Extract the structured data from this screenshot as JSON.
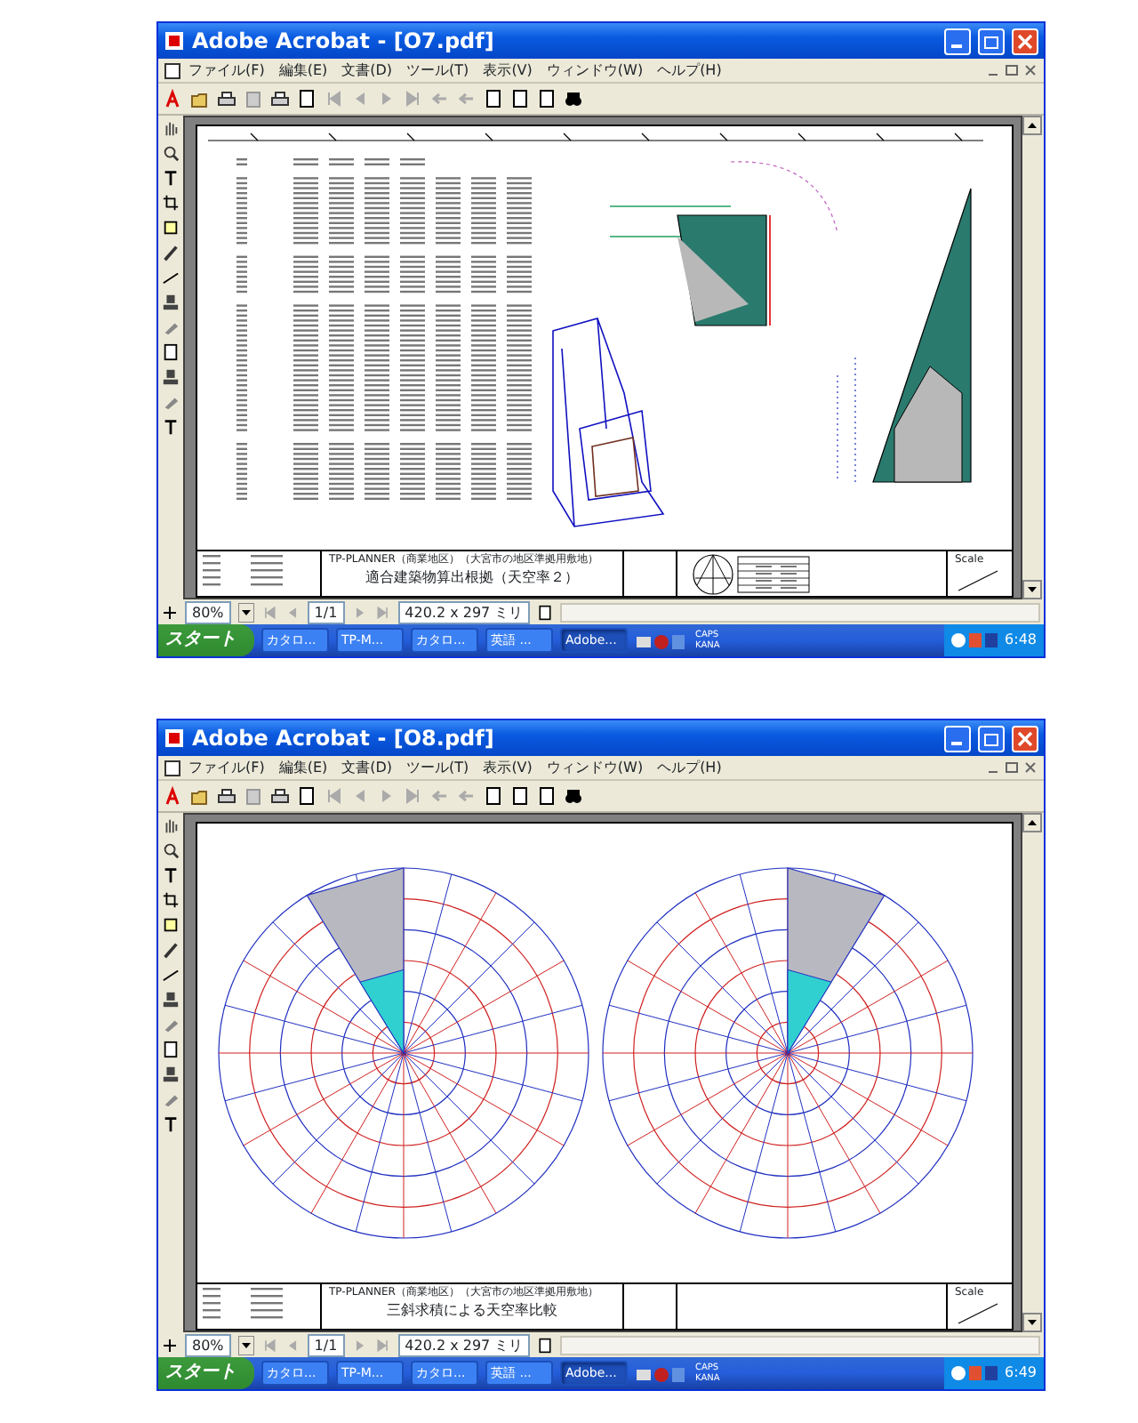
{
  "windows": [
    {
      "title": "Adobe Acrobat - [O7.pdf]",
      "kind": "report",
      "menu": [
        "ファイル(F)",
        "編集(E)",
        "文書(D)",
        "ツール(T)",
        "表示(V)",
        "ウィンドウ(W)",
        "ヘルプ(H)"
      ],
      "title_block": {
        "project": "TP-PLANNER（商業地区）（大宮市の地区準拠用敷地）",
        "title": "適合建築物算出根拠（天空率２）",
        "scale_label": "Scale"
      },
      "status": {
        "zoom": "80%",
        "page": "1/1",
        "size": "420.2 x 297 ミリ"
      },
      "taskbar": {
        "start": "スタート",
        "items": [
          {
            "label": "カタロ...",
            "selected": false
          },
          {
            "label": "TP-M...",
            "selected": false
          },
          {
            "label": "カタロ...",
            "selected": false
          },
          {
            "label": "英語 ...",
            "selected": false
          },
          {
            "label": "Adobe...",
            "selected": true
          }
        ],
        "tray": [
          "CAPS",
          "KANA"
        ],
        "clock": "6:48"
      }
    },
    {
      "title": "Adobe Acrobat - [O8.pdf]",
      "kind": "sky-chart",
      "menu": [
        "ファイル(F)",
        "編集(E)",
        "文書(D)",
        "ツール(T)",
        "表示(V)",
        "ウィンドウ(W)",
        "ヘルプ(H)"
      ],
      "title_block": {
        "project": "TP-PLANNER（商業地区）（大宮市の地区準拠用敷地）",
        "title": "三斜求積による天空率比較",
        "scale_label": "Scale"
      },
      "status": {
        "zoom": "80%",
        "page": "1/1",
        "size": "420.2 x 297 ミリ"
      },
      "taskbar": {
        "start": "スタート",
        "items": [
          {
            "label": "カタロ...",
            "selected": false
          },
          {
            "label": "TP-M...",
            "selected": false
          },
          {
            "label": "カタロ...",
            "selected": false
          },
          {
            "label": "英語 ...",
            "selected": false
          },
          {
            "label": "Adobe...",
            "selected": true
          }
        ],
        "tray": [
          "CAPS",
          "KANA"
        ],
        "clock": "6:49"
      }
    }
  ]
}
